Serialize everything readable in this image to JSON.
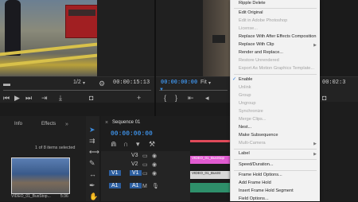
{
  "source_monitor": {
    "fit": "1/2",
    "timecode": "00:00:15:13",
    "current_time": "00:00:00:00"
  },
  "program_monitor": {
    "fit": "Fit",
    "current_time": "00:00:00:00",
    "end_time": "00:02:3"
  },
  "project_panel": {
    "tabs": [
      "Info",
      "Effects"
    ],
    "status": "1 of 8 items selected",
    "clip_name": "VIDEO_01_BusStop...",
    "clip_duration": "5:36"
  },
  "sequence": {
    "tab": "Sequence 01",
    "timecode": "00:00:00:00",
    "tracks": [
      "V3",
      "V2",
      "V1",
      "A1"
    ],
    "source_tracks": [
      "V1",
      "A1"
    ],
    "clips": [
      "VIDEO_01_BusStop",
      "VIDEO_01_BusSt"
    ]
  },
  "context_menu": {
    "items": [
      {
        "label": "Ripple Delete",
        "enabled": true
      },
      {
        "label": "Edit Original",
        "enabled": true
      },
      {
        "label": "Edit in Adobe Photoshop",
        "enabled": false
      },
      {
        "label": "License...",
        "enabled": false
      },
      {
        "label": "Replace With After Effects Composition",
        "enabled": true
      },
      {
        "label": "Replace With Clip",
        "enabled": true,
        "submenu": true
      },
      {
        "label": "Render and Replace...",
        "enabled": true
      },
      {
        "label": "Restore Unrendered",
        "enabled": false
      },
      {
        "label": "Export As Motion Graphics Template...",
        "enabled": false
      },
      {
        "label": "Enable",
        "enabled": true,
        "checked": true
      },
      {
        "label": "Unlink",
        "enabled": false
      },
      {
        "label": "Group",
        "enabled": false
      },
      {
        "label": "Ungroup",
        "enabled": false
      },
      {
        "label": "Synchronize",
        "enabled": false
      },
      {
        "label": "Merge Clips...",
        "enabled": false
      },
      {
        "label": "Nest...",
        "enabled": true
      },
      {
        "label": "Make Subsequence",
        "enabled": true
      },
      {
        "label": "Multi-Camera",
        "enabled": false,
        "submenu": true
      },
      {
        "label": "Label",
        "enabled": true,
        "submenu": true
      },
      {
        "label": "Speed/Duration...",
        "enabled": true
      },
      {
        "label": "Frame Hold Options...",
        "enabled": true
      },
      {
        "label": "Add Frame Hold",
        "enabled": true
      },
      {
        "label": "Insert Frame Hold Segment",
        "enabled": true
      },
      {
        "label": "Field Options...",
        "enabled": true
      }
    ]
  },
  "colors": {
    "timecode_blue": "#3c8bdc",
    "clip_pink": "#e05bd0",
    "audio_green": "#2e8f6a",
    "menu_bg": "#f2f2f2"
  }
}
